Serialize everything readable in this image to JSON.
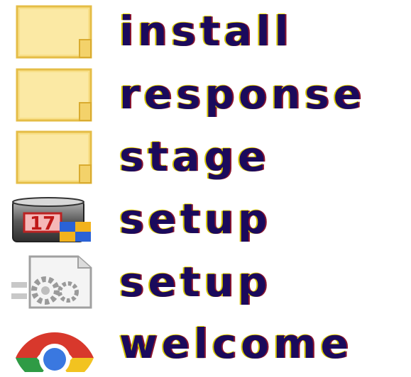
{
  "files": [
    {
      "name": "install",
      "icon": "folder-icon"
    },
    {
      "name": "response",
      "icon": "folder-icon"
    },
    {
      "name": "stage",
      "icon": "folder-icon"
    },
    {
      "name": "setup",
      "icon": "installer-app-icon"
    },
    {
      "name": "setup",
      "icon": "settings-file-icon"
    },
    {
      "name": "welcome",
      "icon": "chrome-html-icon"
    }
  ],
  "colors": {
    "label_text": "#1a0a5c",
    "folder_fill": "#f7de85",
    "folder_edge": "#e9c24a",
    "background": "#ffffff"
  }
}
